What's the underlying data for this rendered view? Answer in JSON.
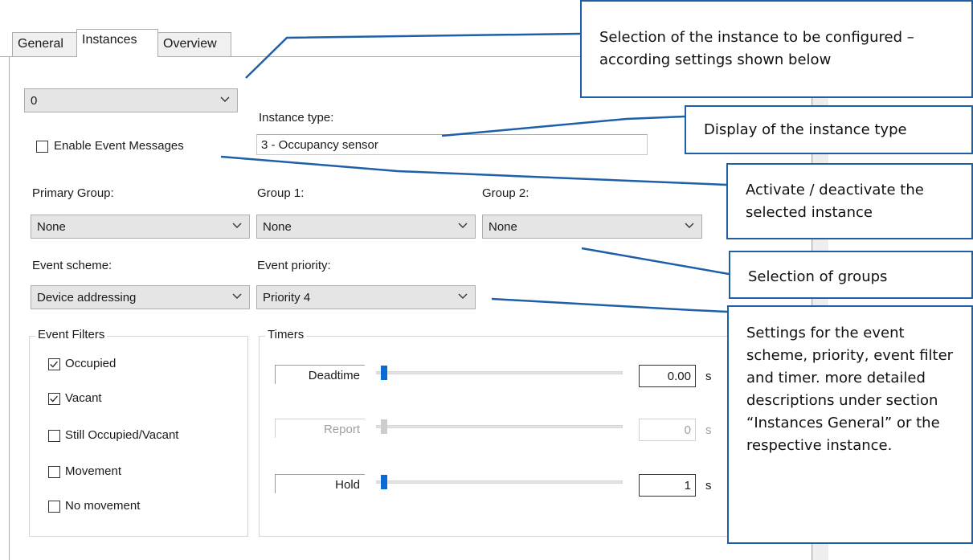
{
  "tabs": [
    {
      "label": "General"
    },
    {
      "label": "Instances"
    },
    {
      "label": "Overview"
    }
  ],
  "instance_select": {
    "value": "0"
  },
  "instance_type": {
    "label": "Instance type:",
    "value": "3 - Occupancy sensor"
  },
  "enable_event": {
    "label": "Enable Event Messages",
    "checked": false
  },
  "groups": {
    "primary": {
      "label": "Primary Group:",
      "value": "None"
    },
    "group1": {
      "label": "Group 1:",
      "value": "None"
    },
    "group2": {
      "label": "Group 2:",
      "value": "None"
    }
  },
  "event_scheme": {
    "label": "Event scheme:",
    "value": "Device addressing"
  },
  "event_priority": {
    "label": "Event priority:",
    "value": "Priority 4"
  },
  "event_filters": {
    "title": "Event Filters",
    "items": [
      {
        "label": "Occupied",
        "checked": true
      },
      {
        "label": "Vacant",
        "checked": true
      },
      {
        "label": "Still Occupied/Vacant",
        "checked": false
      },
      {
        "label": "Movement",
        "checked": false
      },
      {
        "label": "No movement",
        "checked": false
      }
    ]
  },
  "timers": {
    "title": "Timers",
    "rows": [
      {
        "label": "Deadtime",
        "value": "0.00",
        "unit": "s",
        "enabled": true
      },
      {
        "label": "Report",
        "value": "0",
        "unit": "s",
        "enabled": false
      },
      {
        "label": "Hold",
        "value": "1",
        "unit": "s",
        "enabled": true
      }
    ]
  },
  "callouts": {
    "instance": "Selection of the instance to be configured – according settings shown below",
    "type": "Display of the instance type",
    "activate": "Activate / deactivate the selected instance",
    "groups": "Selection of groups",
    "settings": "Settings for the event scheme, priority, event filter and timer. more detailed descriptions under section “Instances General” or the respective instance."
  },
  "colors": {
    "callout_border": "#1f5fa8",
    "slider_thumb": "#0b6bd3"
  }
}
